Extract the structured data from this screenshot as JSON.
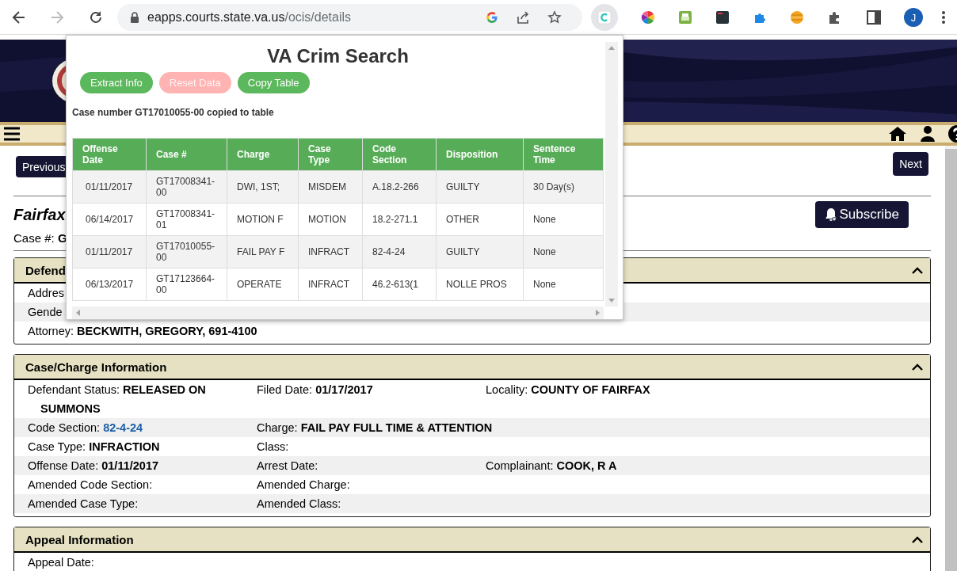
{
  "browser": {
    "url_host": "eapps.courts.state.va.us",
    "url_path": "/ocis/details",
    "profile_initial": "J"
  },
  "page": {
    "previous_button": "Previous",
    "next_button": "Next",
    "court_title": "Fairfax",
    "case_number_label": "Case #:",
    "case_number_value": "G",
    "subscribe_button": "Subscribe",
    "panels": [
      {
        "title": "Defend",
        "expanded": true,
        "rows": [
          {
            "fields": [
              {
                "label": "Addres",
                "kind": "text"
              }
            ]
          },
          {
            "fields": [
              {
                "label": "Gende",
                "kind": "text"
              }
            ]
          },
          {
            "fields": [
              {
                "label": "Attorney:",
                "value": "BECKWITH, GREGORY, 691-4100",
                "kind": "text"
              }
            ]
          }
        ]
      },
      {
        "title": "Case/Charge Information",
        "expanded": true,
        "rows": [
          {
            "fields": [
              {
                "label": "Defendant Status:",
                "value": "RELEASED ON SUMMONS",
                "kind": "text"
              },
              {
                "label": "Filed Date:",
                "value": "01/17/2017",
                "kind": "text"
              },
              {
                "label": "Locality:",
                "value": "COUNTY OF FAIRFAX",
                "kind": "text"
              }
            ]
          },
          {
            "fields": [
              {
                "label": "Code Section:",
                "value": "82-4-24",
                "kind": "link"
              },
              {
                "label": "Charge:",
                "value": "FAIL PAY FULL TIME & ATTENTION",
                "kind": "text"
              }
            ]
          },
          {
            "fields": [
              {
                "label": "Case Type:",
                "value": "INFRACTION",
                "kind": "text"
              },
              {
                "label": "Class:",
                "kind": "text"
              }
            ]
          },
          {
            "fields": [
              {
                "label": "Offense Date:",
                "value": "01/11/2017",
                "kind": "text"
              },
              {
                "label": "Arrest Date:",
                "kind": "text"
              },
              {
                "label": "Complainant:",
                "value": "COOK, R A",
                "kind": "text"
              }
            ]
          },
          {
            "fields": [
              {
                "label": "Amended Code Section:",
                "kind": "text"
              },
              {
                "label": "Amended Charge:",
                "kind": "text"
              }
            ]
          },
          {
            "fields": [
              {
                "label": "Amended Case Type:",
                "kind": "text"
              },
              {
                "label": "Amended Class:",
                "kind": "text"
              }
            ]
          }
        ]
      },
      {
        "title": "Appeal Information",
        "expanded": true,
        "rows": [
          {
            "fields": [
              {
                "label": "Appeal Date:",
                "kind": "text"
              }
            ]
          }
        ]
      }
    ]
  },
  "extension_popup": {
    "title": "VA Crim Search",
    "buttons": [
      {
        "label": "Extract Info",
        "disabled": false
      },
      {
        "label": "Reset Data",
        "disabled": true
      },
      {
        "label": "Copy Table",
        "disabled": false
      }
    ],
    "message": "Case number GT17010055-00 copied to table",
    "table": {
      "columns": [
        "Offense Date",
        "Case #",
        "Charge",
        "Case Type",
        "Code Section",
        "Disposition",
        "Sentence Time"
      ],
      "rows": [
        [
          "01/11/2017",
          "GT17008341-00",
          "DWI, 1ST;",
          "MISDEM",
          "A.18.2-266",
          "GUILTY",
          "30 Day(s)"
        ],
        [
          "06/14/2017",
          "GT17008341-01",
          "MOTION F",
          "MOTION",
          "18.2-271.1",
          "OTHER",
          "None"
        ],
        [
          "01/11/2017",
          "GT17010055-00",
          "FAIL PAY F",
          "INFRACT",
          "82-4-24",
          "GUILTY",
          "None"
        ],
        [
          "06/13/2017",
          "GT17123664-00",
          "OPERATE",
          "INFRACT",
          "46.2-613(1",
          "NOLLE PROS",
          "None"
        ]
      ]
    }
  }
}
